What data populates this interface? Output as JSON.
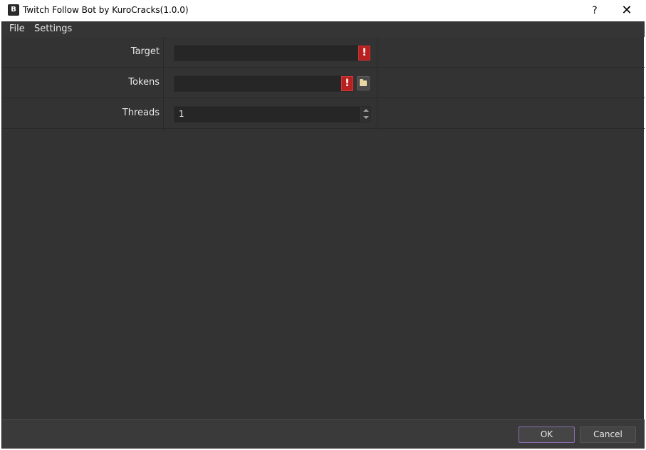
{
  "window": {
    "title": "Twitch Follow Bot by KuroCracks(1.0.0)",
    "icon_letter": "B",
    "help_label": "?",
    "close_label": "✕"
  },
  "menu": {
    "items": [
      {
        "label": "File"
      },
      {
        "label": "Settings"
      }
    ]
  },
  "form": {
    "target": {
      "label": "Target",
      "value": ""
    },
    "tokens": {
      "label": "Tokens",
      "value": ""
    },
    "threads": {
      "label": "Threads",
      "value": "1"
    }
  },
  "buttons": {
    "ok": "OK",
    "cancel": "Cancel"
  },
  "colors": {
    "background": "#333333",
    "error": "#b81f1f",
    "accent": "#8a6bb0"
  },
  "icons": {
    "error": "exclamation-icon",
    "browse": "folder-icon"
  }
}
